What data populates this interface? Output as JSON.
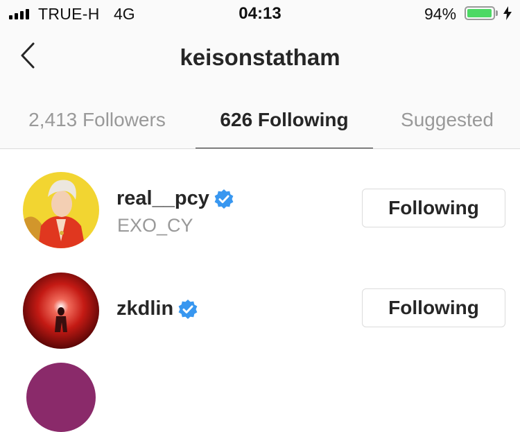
{
  "status_bar": {
    "carrier": "TRUE-H",
    "network": "4G",
    "time": "04:13",
    "battery_percent": "94%",
    "battery_level": 0.94,
    "battery_color": "#4cd964"
  },
  "header": {
    "title": "keisonstatham",
    "back_icon": "chevron-left-icon"
  },
  "tabs": [
    {
      "label": "2,413 Followers",
      "active": false
    },
    {
      "label": "626 Following",
      "active": true
    },
    {
      "label": "Suggested",
      "active": false
    }
  ],
  "users": [
    {
      "username": "real__pcy",
      "full_name": "EXO_CY",
      "verified": true,
      "button_label": "Following"
    },
    {
      "username": "zkdlin",
      "full_name": "",
      "verified": true,
      "button_label": "Following"
    }
  ],
  "colors": {
    "verified_badge": "#3897f0",
    "secondary_text": "#999999",
    "border": "#dbdbdb"
  }
}
